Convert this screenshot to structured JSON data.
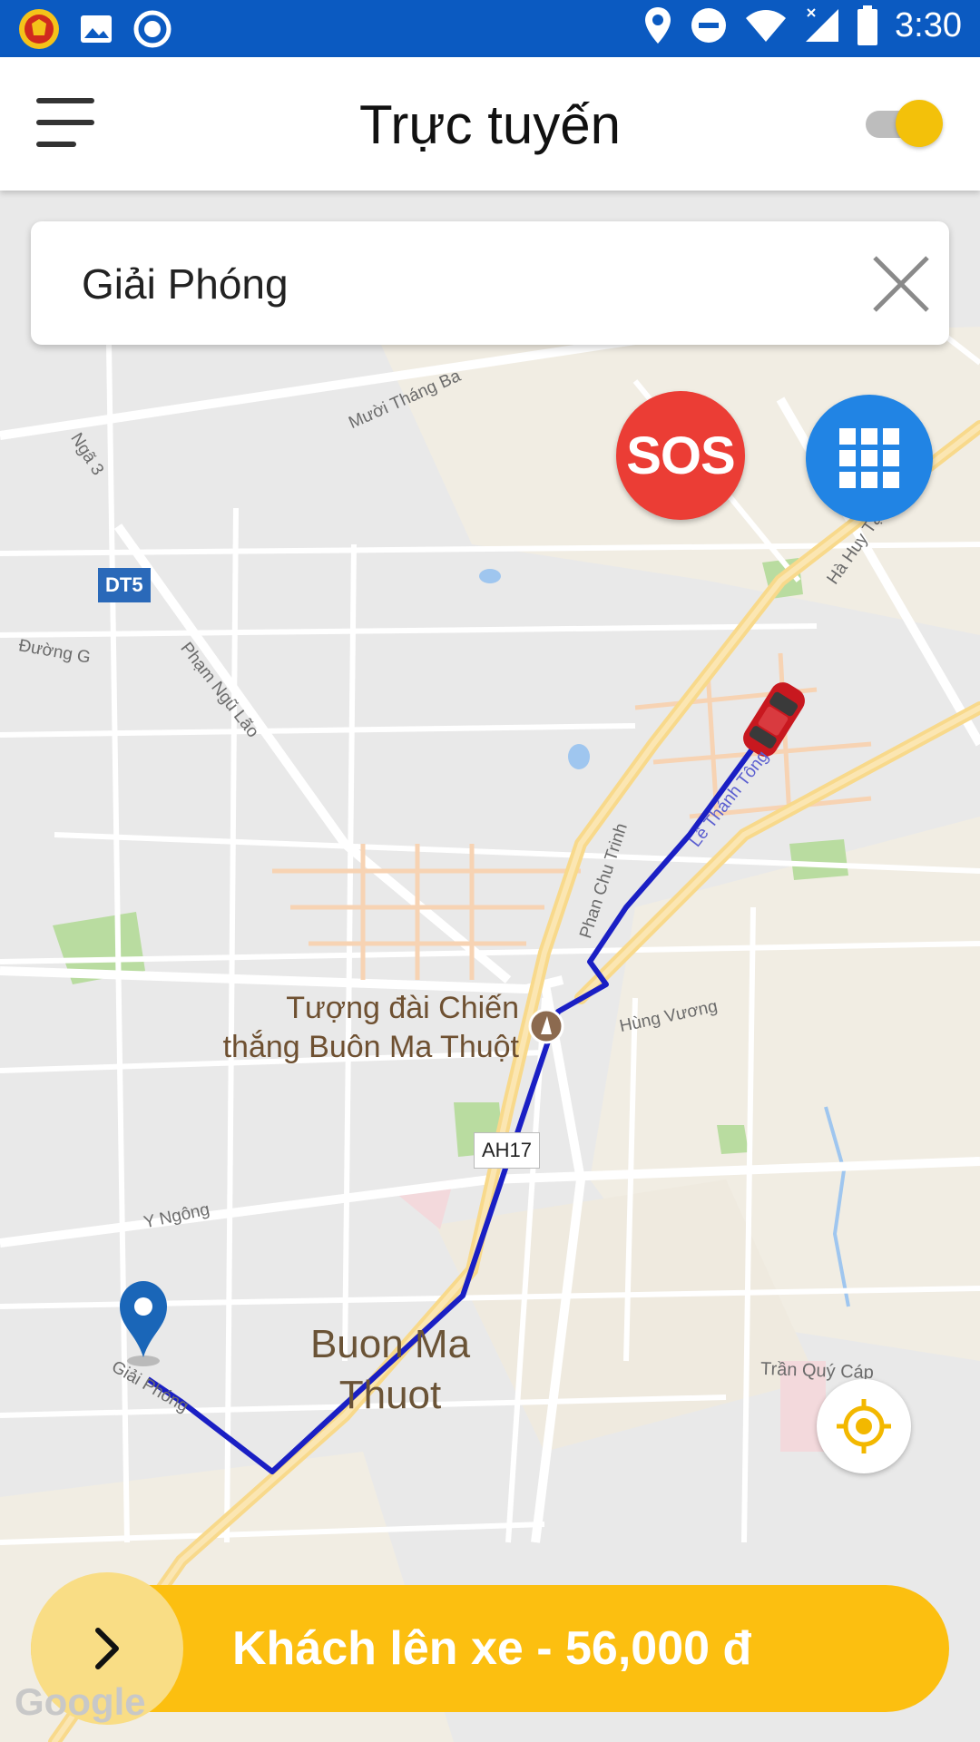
{
  "status_bar": {
    "time": "3:30",
    "left_icons": [
      "app-logo-icon",
      "gallery-icon",
      "record-icon"
    ],
    "right_icons": [
      "location-icon",
      "do-not-disturb-icon",
      "wifi-icon",
      "signal-icon",
      "battery-icon"
    ],
    "background": "#0b5ac1"
  },
  "header": {
    "title": "Trực tuyến",
    "menu_icon": "hamburger-menu-icon",
    "online_toggle": {
      "on": true,
      "color": "#f3c10a"
    }
  },
  "search": {
    "value": "Giải Phóng",
    "clear_icon": "close-icon"
  },
  "buttons": {
    "sos_label": "SOS",
    "sos_color": "#eb3d35",
    "apps_icon": "grid-icon",
    "apps_color": "#2184e4",
    "locate_icon": "my-location-icon"
  },
  "map": {
    "street_labels": {
      "muoi_thang_ba": "Mười Tháng Ba",
      "nga_3": "Ngã 3",
      "duong_g": "Đường G",
      "pham_ngu_lao": "Phạm Ngũ Lão",
      "ha_huy_tap": "Hà Huy Tập",
      "le_thanh_tong": "Lê Thánh Tông",
      "phan_chu_trinh": "Phan Chu Trinh",
      "hung_vuong": "Hùng Vương",
      "y_ngong": "Y Ngông",
      "giai_phong": "Giải Phóng",
      "tran_quy_cap": "Trần Quý Cáp"
    },
    "route_shields": {
      "dt5": "DT5",
      "ah17": "AH17"
    },
    "poi": {
      "line1": "Tượng đài Chiến",
      "line2": "thắng Buôn Ma Thuột"
    },
    "city": {
      "line1": "Buon Ma",
      "line2": "Thuot"
    },
    "route_color": "#1a1fc4",
    "vehicle_icon": "red-car-icon",
    "destination_icon": "map-pin-icon",
    "attribution": "Google"
  },
  "action": {
    "label": "Khách lên xe - 56,000 đ",
    "icon": "chevron-right-icon",
    "color": "#fcbf10"
  }
}
